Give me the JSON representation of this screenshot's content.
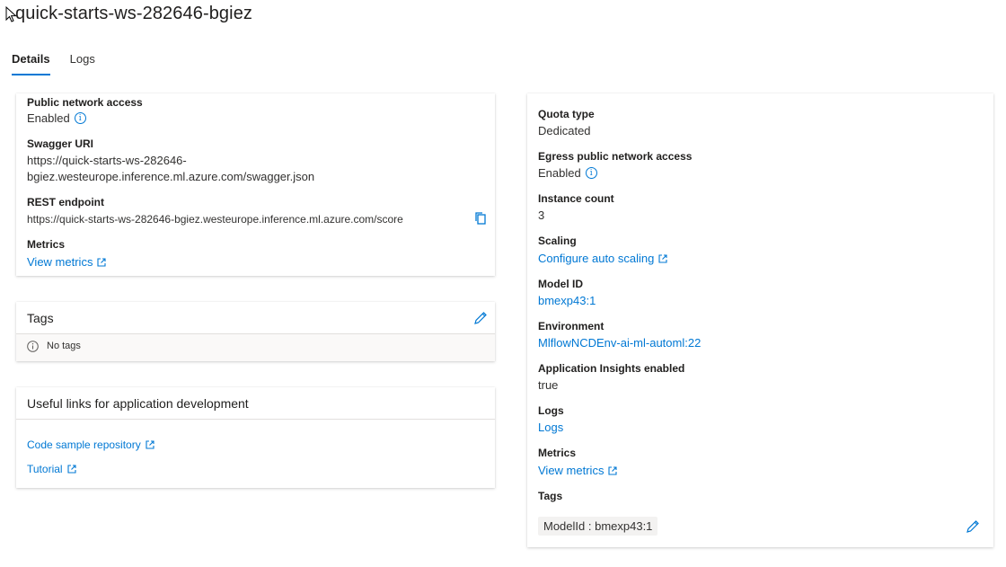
{
  "title": "quick-starts-ws-282646-bgiez",
  "tabs": [
    {
      "label": "Details"
    },
    {
      "label": "Logs"
    }
  ],
  "left": {
    "public_network_access": {
      "label": "Public network access",
      "value": "Enabled"
    },
    "swagger": {
      "label": "Swagger URI",
      "line1": "https://quick-starts-ws-282646-",
      "line2": "bgiez.westeurope.inference.ml.azure.com/swagger.json"
    },
    "rest": {
      "label": "REST endpoint",
      "value": "https://quick-starts-ws-282646-bgiez.westeurope.inference.ml.azure.com/score"
    },
    "metrics": {
      "label": "Metrics",
      "link": "View metrics"
    }
  },
  "tags_card": {
    "title": "Tags",
    "empty": "No tags"
  },
  "links_card": {
    "title": "Useful links for application development",
    "links": [
      "Code sample repository",
      "Tutorial"
    ]
  },
  "right": {
    "quota": {
      "label": "Quota type",
      "value": "Dedicated"
    },
    "egress": {
      "label": "Egress public network access",
      "value": "Enabled"
    },
    "instance": {
      "label": "Instance count",
      "value": "3"
    },
    "scaling": {
      "label": "Scaling",
      "link": "Configure auto scaling"
    },
    "model": {
      "label": "Model ID",
      "link": "bmexp43:1"
    },
    "environment": {
      "label": "Environment",
      "link": "MlflowNCDEnv-ai-ml-automl:22"
    },
    "insights": {
      "label": "Application Insights enabled",
      "value": "true"
    },
    "logs": {
      "label": "Logs",
      "link": "Logs"
    },
    "metrics": {
      "label": "Metrics",
      "link": "View metrics"
    },
    "tags": {
      "label": "Tags",
      "pill": "ModelId : bmexp43:1"
    }
  },
  "colors": {
    "accent": "#0078d4",
    "text": "#323130"
  }
}
